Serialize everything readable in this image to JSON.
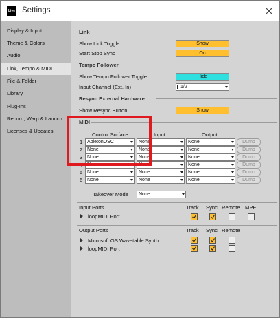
{
  "window": {
    "title": "Settings",
    "app_icon_text": "Live"
  },
  "sidebar": {
    "items": [
      {
        "label": "Display & Input",
        "active": false
      },
      {
        "label": "Theme & Colors",
        "active": false
      },
      {
        "label": "Audio",
        "active": false
      },
      {
        "label": "Link, Tempo & MIDI",
        "active": true
      },
      {
        "label": "File & Folder",
        "active": false
      },
      {
        "label": "Library",
        "active": false
      },
      {
        "label": "Plug-Ins",
        "active": false
      },
      {
        "label": "Record, Warp & Launch",
        "active": false
      },
      {
        "label": "Licenses & Updates",
        "active": false
      }
    ]
  },
  "link": {
    "header": "Link",
    "show_link_toggle": {
      "label": "Show Link Toggle",
      "value": "Show"
    },
    "start_stop_sync": {
      "label": "Start Stop Sync",
      "value": "On"
    }
  },
  "tempo_follower": {
    "header": "Tempo Follower",
    "show_toggle": {
      "label": "Show Tempo Follower Toggle",
      "value": "Hide"
    },
    "input_channel": {
      "label": "Input Channel (Ext. In)",
      "value": "1/2"
    }
  },
  "resync": {
    "header": "Resync External Hardware",
    "show_button": {
      "label": "Show Resync Button",
      "value": "Show"
    }
  },
  "midi": {
    "header": "MIDI",
    "columns": {
      "control_surface": "Control Surface",
      "input": "Input",
      "output": "Output"
    },
    "dump_label": "Dump",
    "rows": [
      {
        "num": "1",
        "surface": "AbletonOSC",
        "input": "None",
        "output": "None"
      },
      {
        "num": "2",
        "surface": "None",
        "input": "None",
        "output": "None"
      },
      {
        "num": "3",
        "surface": "None",
        "input": "None",
        "output": "None"
      },
      {
        "num": "4",
        "surface": "None",
        "input": "None",
        "output": "None"
      },
      {
        "num": "5",
        "surface": "None",
        "input": "None",
        "output": "None"
      },
      {
        "num": "6",
        "surface": "None",
        "input": "None",
        "output": "None"
      }
    ],
    "takeover": {
      "label": "Takeover Mode",
      "value": "None"
    }
  },
  "input_ports": {
    "header": "Input Ports",
    "col_track": "Track",
    "col_sync": "Sync",
    "col_remote": "Remote",
    "col_mpe": "MPE",
    "ports": [
      {
        "name": "loopMIDI Port",
        "track": true,
        "sync": true,
        "remote": false,
        "mpe": false
      }
    ]
  },
  "output_ports": {
    "header": "Output Ports",
    "col_track": "Track",
    "col_sync": "Sync",
    "col_remote": "Remote",
    "ports": [
      {
        "name": "Microsoft GS Wavetable Synth",
        "track": true,
        "sync": true,
        "remote": false
      },
      {
        "name": "loopMIDI Port",
        "track": true,
        "sync": true,
        "remote": false
      }
    ]
  },
  "colors": {
    "accent_yellow": "#ffbf2e",
    "accent_cyan": "#2fe0e0",
    "highlight_red": "#e0191e"
  }
}
